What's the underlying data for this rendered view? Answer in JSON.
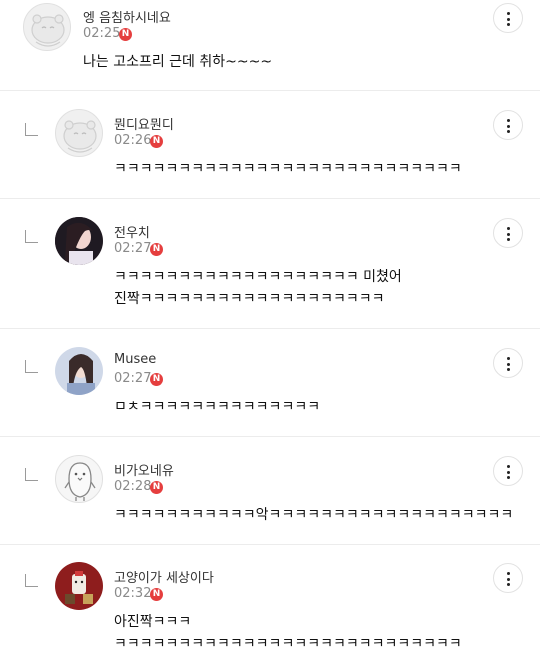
{
  "comments": [
    {
      "nick": "엥 음침하시네요",
      "time": "02:25",
      "badge": "N",
      "lines": [
        "나는 고소프리 근데 취하~~~~"
      ],
      "avatar": "default-bear-avatar"
    },
    {
      "nick": "뭔디요뭔디",
      "time": "02:26",
      "badge": "N",
      "lines": [
        "ㅋㅋㅋㅋㅋㅋㅋㅋㅋㅋㅋㅋㅋㅋㅋㅋㅋㅋㅋㅋㅋㅋㅋㅋㅋㅋㅋ"
      ],
      "avatar": "default-bear-avatar"
    },
    {
      "nick": "전우치",
      "time": "02:27",
      "badge": "N",
      "lines": [
        "ㅋㅋㅋㅋㅋㅋㅋㅋㅋㅋㅋㅋㅋㅋㅋㅋㅋㅋㅋ 미쳤어",
        "진짝ㅋㅋㅋㅋㅋㅋㅋㅋㅋㅋㅋㅋㅋㅋㅋㅋㅋㅋㅋ"
      ],
      "avatar": "photo-woman-avatar"
    },
    {
      "nick": "Musee",
      "time": "02:27",
      "badge": "N",
      "lines": [
        "ㅁㅊㅋㅋㅋㅋㅋㅋㅋㅋㅋㅋㅋㅋㅋㅋ"
      ],
      "avatar": "photo-woman-avatar"
    },
    {
      "nick": "비가오네유",
      "time": "02:28",
      "badge": "N",
      "lines": [
        "ㅋㅋㅋㅋㅋㅋㅋㅋㅋㅋㅋ악ㅋㅋㅋㅋㅋㅋㅋㅋㅋㅋㅋㅋㅋㅋㅋㅋㅋㅋㅋ"
      ],
      "avatar": "penguin-avatar"
    },
    {
      "nick": "고양이가 세상이다",
      "time": "02:32",
      "badge": "N",
      "lines": [
        "아진짝ㅋㅋㅋ",
        "ㅋㅋㅋㅋㅋㅋㅋㅋㅋㅋㅋㅋㅋㅋㅋㅋㅋㅋㅋㅋㅋㅋㅋㅋㅋㅋㅋ"
      ],
      "avatar": "cat-figure-avatar"
    }
  ],
  "icons": {
    "more": "more-vertical-icon",
    "reply": "reply-arrow-icon",
    "badge": "new-badge-icon"
  },
  "colors": {
    "badge": "#e53e3e",
    "divider": "#ececec",
    "time": "#8a8a8a"
  }
}
